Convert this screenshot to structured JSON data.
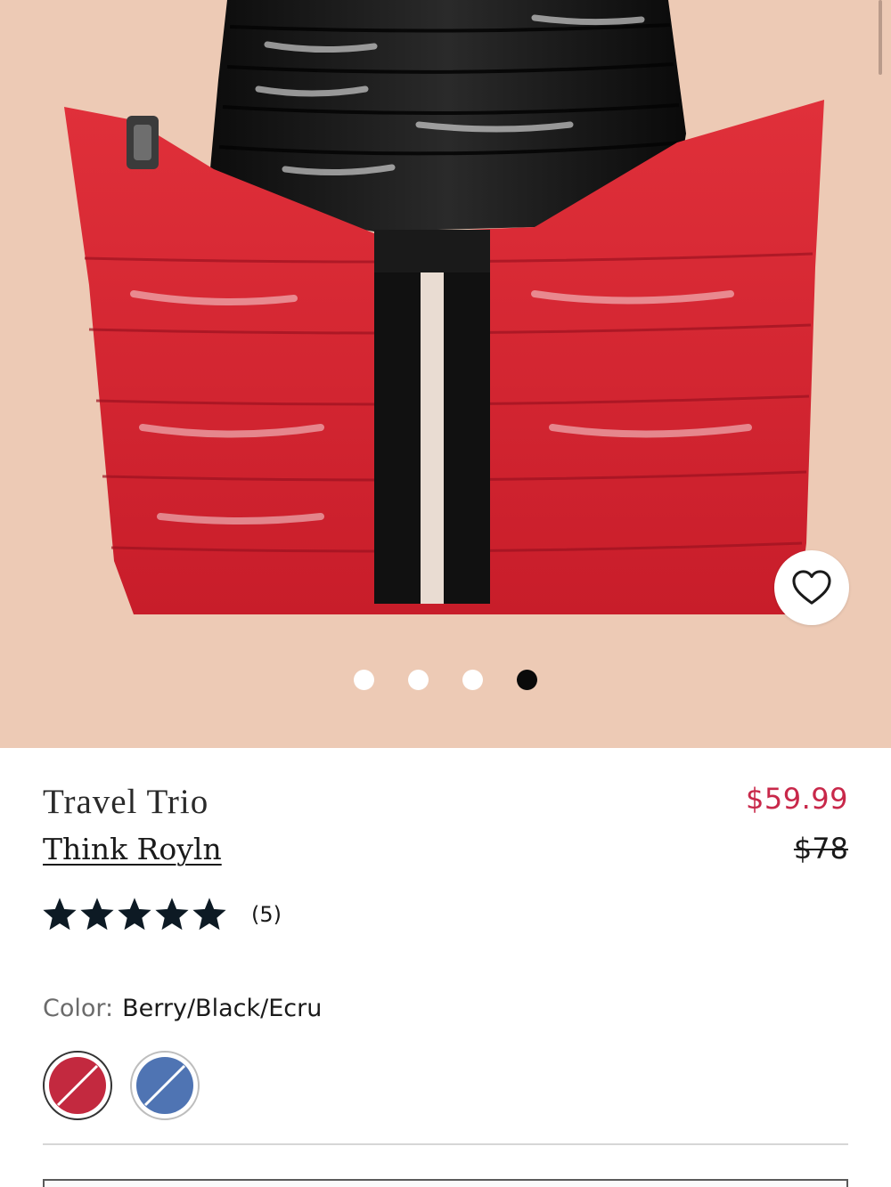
{
  "product": {
    "title": "Travel Trio",
    "brand": "Think Royln",
    "sale_price": "$59.99",
    "original_price": "$78"
  },
  "rating": {
    "stars": 5,
    "max_stars": 5,
    "count_label": "(5)"
  },
  "color": {
    "label": "Color:",
    "value": "Berry/Black/Ecru"
  },
  "swatches": [
    {
      "name": "Berry/Black/Ecru",
      "color": "#c3293f",
      "selected": true
    },
    {
      "name": "Blue",
      "color": "#4f74b3",
      "selected": false
    }
  ],
  "gallery": {
    "image_count": 4,
    "active_index": 3
  },
  "icons": {
    "favorite": "heart-outline-icon",
    "rating": "star-filled-icon"
  },
  "colors": {
    "sale_price": "#c8284a",
    "image_background": "#edcab5",
    "star": "#0d1a24"
  }
}
